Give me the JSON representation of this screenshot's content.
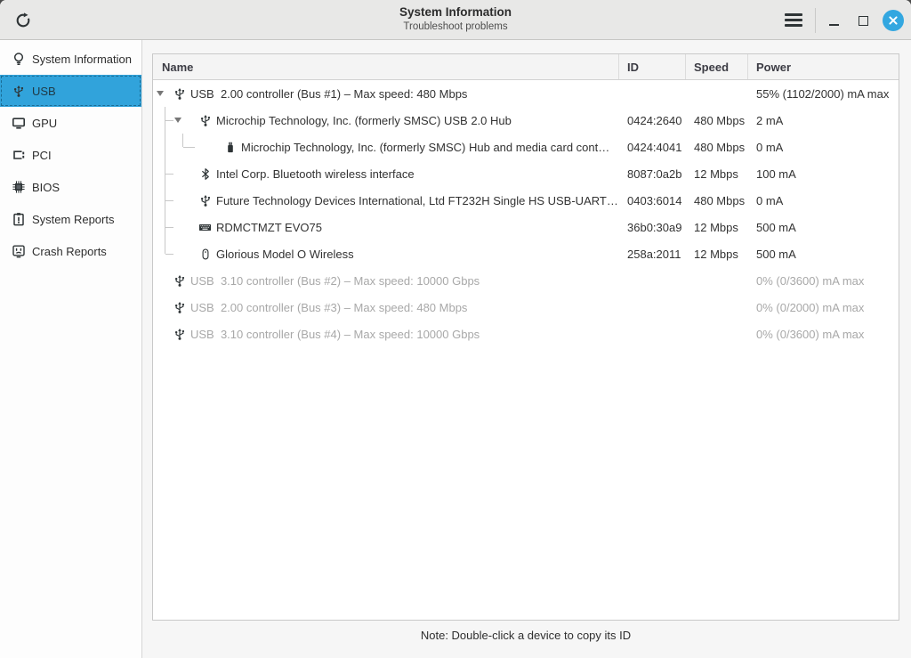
{
  "titlebar": {
    "title": "System Information",
    "subtitle": "Troubleshoot problems",
    "icons": {
      "refresh": "circular-arrow",
      "menu": "hamburger",
      "minimize": "dash",
      "maximize": "square-outline",
      "close": "x-in-circle"
    }
  },
  "sidebar": {
    "items": [
      {
        "label": "System Information",
        "icon": "lightbulb",
        "selected": false
      },
      {
        "label": "USB",
        "icon": "usb",
        "selected": true
      },
      {
        "label": "GPU",
        "icon": "monitor",
        "selected": false
      },
      {
        "label": "PCI",
        "icon": "pci-card",
        "selected": false
      },
      {
        "label": "BIOS",
        "icon": "chip",
        "selected": false
      },
      {
        "label": "System Reports",
        "icon": "clipboard-alert",
        "selected": false
      },
      {
        "label": "Crash Reports",
        "icon": "crash-face",
        "selected": false
      }
    ]
  },
  "table": {
    "columns": [
      "Name",
      "ID",
      "Speed",
      "Power"
    ],
    "rows": [
      {
        "name": "USB  2.00 controller (Bus #1) – Max speed: 480 Mbps",
        "id": "",
        "speed": "",
        "power": "55% (1102/2000) mA max",
        "icon": "usb",
        "level": 0,
        "expander": true,
        "dim": false,
        "lines": [],
        "conn": null
      },
      {
        "name": "Microchip Technology, Inc. (formerly SMSC) USB 2.0 Hub",
        "id": "0424:2640",
        "speed": "480 Mbps",
        "power": "2 mA",
        "icon": "usb",
        "level": 1,
        "expander": true,
        "dim": false,
        "lines": [],
        "conn": {
          "col": 0,
          "type": "branch"
        }
      },
      {
        "name": "Microchip Technology, Inc. (formerly SMSC) Hub and media card cont…",
        "id": "0424:4041",
        "speed": "480 Mbps",
        "power": "0 mA",
        "icon": "flash-drive",
        "level": 2,
        "expander": false,
        "dim": false,
        "lines": [
          0
        ],
        "conn": {
          "col": 1,
          "type": "corner"
        }
      },
      {
        "name": "Intel Corp. Bluetooth wireless interface",
        "id": "8087:0a2b",
        "speed": "12 Mbps",
        "power": "100 mA",
        "icon": "bluetooth",
        "level": 1,
        "expander": false,
        "dim": false,
        "lines": [],
        "conn": {
          "col": 0,
          "type": "branch"
        }
      },
      {
        "name": "Future Technology Devices International, Ltd FT232H Single HS USB-UART…",
        "id": "0403:6014",
        "speed": "480 Mbps",
        "power": "0 mA",
        "icon": "usb",
        "level": 1,
        "expander": false,
        "dim": false,
        "lines": [],
        "conn": {
          "col": 0,
          "type": "branch"
        }
      },
      {
        "name": "RDMCTMZT EVO75",
        "id": "36b0:30a9",
        "speed": "12 Mbps",
        "power": "500 mA",
        "icon": "keyboard",
        "level": 1,
        "expander": false,
        "dim": false,
        "lines": [],
        "conn": {
          "col": 0,
          "type": "branch"
        }
      },
      {
        "name": "Glorious Model O Wireless",
        "id": "258a:2011",
        "speed": "12 Mbps",
        "power": "500 mA",
        "icon": "mouse",
        "level": 1,
        "expander": false,
        "dim": false,
        "lines": [],
        "conn": {
          "col": 0,
          "type": "corner"
        }
      },
      {
        "name": "USB  3.10 controller (Bus #2) – Max speed: 10000 Gbps",
        "id": "",
        "speed": "",
        "power": "0% (0/3600) mA max",
        "icon": "usb",
        "level": 0,
        "expander": false,
        "dim": true,
        "lines": [],
        "conn": null
      },
      {
        "name": "USB  2.00 controller (Bus #3) – Max speed: 480 Mbps",
        "id": "",
        "speed": "",
        "power": "0% (0/2000) mA max",
        "icon": "usb",
        "level": 0,
        "expander": false,
        "dim": true,
        "lines": [],
        "conn": null
      },
      {
        "name": "USB  3.10 controller (Bus #4) – Max speed: 10000 Gbps",
        "id": "",
        "speed": "",
        "power": "0% (0/3600) mA max",
        "icon": "usb",
        "level": 0,
        "expander": false,
        "dim": true,
        "lines": [],
        "conn": null
      }
    ]
  },
  "footer": {
    "note": "Note: Double-click a device to copy its ID"
  },
  "colors": {
    "accent": "#31a3db",
    "close_button": "#33a7e0",
    "dim_text": "#a8a8a8",
    "tree_line": "#c8c8c8"
  }
}
